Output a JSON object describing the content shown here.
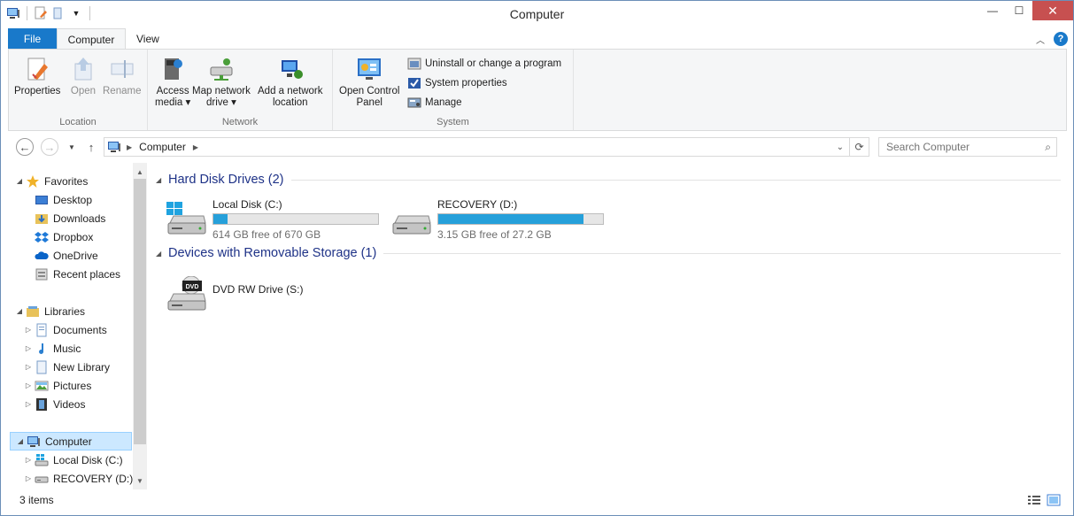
{
  "window": {
    "title": "Computer",
    "controls": {
      "minimize": "—",
      "maximize": "☐",
      "close": "✕"
    }
  },
  "ribbon": {
    "tabs": [
      {
        "label": "File"
      },
      {
        "label": "Computer"
      },
      {
        "label": "View"
      }
    ],
    "groups": {
      "location": {
        "label": "Location",
        "buttons": [
          {
            "label": "Properties",
            "icon": "properties-icon"
          },
          {
            "label": "Open",
            "icon": "open-icon"
          },
          {
            "label": "Rename",
            "icon": "rename-icon"
          }
        ]
      },
      "network": {
        "label": "Network",
        "buttons": [
          {
            "line1": "Access",
            "line2": "media ▾",
            "icon": "access-media-icon"
          },
          {
            "line1": "Map network",
            "line2": "drive ▾",
            "icon": "map-network-drive-icon"
          },
          {
            "line1": "Add a network",
            "line2": "location",
            "icon": "add-network-location-icon"
          }
        ]
      },
      "system": {
        "label": "System",
        "open_control_panel": {
          "line1": "Open Control",
          "line2": "Panel"
        },
        "small_buttons": [
          {
            "label": "Uninstall or change a program",
            "icon": "uninstall-icon"
          },
          {
            "label": "System properties",
            "icon": "system-properties-icon"
          },
          {
            "label": "Manage",
            "icon": "manage-icon"
          }
        ]
      }
    }
  },
  "address": {
    "path": "Computer",
    "search_placeholder": "Search Computer"
  },
  "navpane": {
    "favorites": {
      "label": "Favorites",
      "items": [
        "Desktop",
        "Downloads",
        "Dropbox",
        "OneDrive",
        "Recent places"
      ]
    },
    "libraries": {
      "label": "Libraries",
      "items": [
        "Documents",
        "Music",
        "New Library",
        "Pictures",
        "Videos"
      ]
    },
    "computer": {
      "label": "Computer",
      "items": [
        "Local Disk (C:)",
        "RECOVERY (D:)"
      ]
    }
  },
  "content": {
    "hard_disks": {
      "title": "Hard Disk Drives (2)",
      "drives": [
        {
          "name": "Local Disk (C:)",
          "free": "614 GB free of 670 GB",
          "used_fraction": 0.084
        },
        {
          "name": "RECOVERY (D:)",
          "free": "3.15 GB free of 27.2 GB",
          "used_fraction": 0.884
        }
      ]
    },
    "removable": {
      "title": "Devices with Removable Storage (1)",
      "devices": [
        {
          "name": "DVD RW Drive (S:)",
          "badge": "DVD"
        }
      ]
    }
  },
  "status": {
    "items_count": "3 items"
  },
  "colors": {
    "accent": "#1979ca",
    "bar_fill": "#26a0da",
    "section_title": "#1e3287",
    "selection": "#cce8ff"
  }
}
